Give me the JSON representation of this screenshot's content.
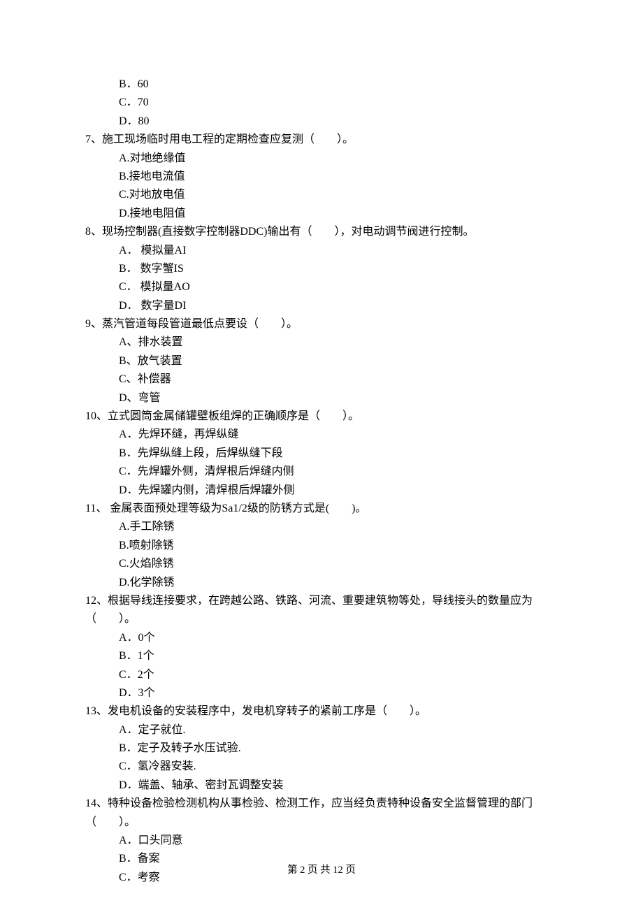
{
  "continued_options": [
    "B．60",
    "C．70",
    "D．80"
  ],
  "questions": [
    {
      "stem_lines": [
        "7、施工现场临时用电工程的定期检查应复测（　　）。"
      ],
      "options": [
        "A.对地绝缘值",
        "B.接地电流值",
        "C.对地放电值",
        "D.接地电阻值"
      ]
    },
    {
      "stem_lines": [
        "8、现场控制器(直接数字控制器DDC)输出有（　　），对电动调节阀进行控制。"
      ],
      "options": [
        "A． 模拟量AI",
        "B． 数字蟹IS",
        "C． 模拟量AO",
        "D． 数字量DI"
      ]
    },
    {
      "stem_lines": [
        "9、蒸汽管道每段管道最低点要设（　　）。"
      ],
      "options": [
        "A、排水装置",
        "B、放气装置",
        "C、补偿器",
        "D、弯管"
      ]
    },
    {
      "stem_lines": [
        "10、立式圆筒金属储罐壁板组焊的正确顺序是（　　）。"
      ],
      "options": [
        "A．先焊环缝，再焊纵缝",
        "B．先焊纵缝上段，后焊纵缝下段",
        "C．先焊罐外侧，清焊根后焊缝内侧",
        "D．先焊罐内侧，清焊根后焊罐外侧"
      ]
    },
    {
      "stem_lines": [
        "11、 金属表面预处理等级为Sa1/2级的防锈方式是(　　)。"
      ],
      "options": [
        "A.手工除锈",
        "B.喷射除锈",
        "C.火焰除锈",
        "D.化学除锈"
      ]
    },
    {
      "stem_lines": [
        "12、根据导线连接要求，在跨越公路、铁路、河流、重要建筑物等处，导线接头的数量应为",
        "（　　）。"
      ],
      "options": [
        "A．0个",
        "B．1个",
        "C．2个",
        "D．3个"
      ]
    },
    {
      "stem_lines": [
        "13、发电机设备的安装程序中，发电机穿转子的紧前工序是（　　）。"
      ],
      "options": [
        "A．定子就位.",
        "B．定子及转子水压试验.",
        "C．氢冷器安装.",
        "D．端盖、轴承、密封瓦调整安装"
      ]
    },
    {
      "stem_lines": [
        "14、特种设备检验检测机构从事检验、检测工作，应当经负责特种设备安全监督管理的部门",
        "（　　）。"
      ],
      "options": [
        "A．口头同意",
        "B．备案",
        "C．考察"
      ]
    }
  ],
  "footer": "第 2 页 共 12 页"
}
